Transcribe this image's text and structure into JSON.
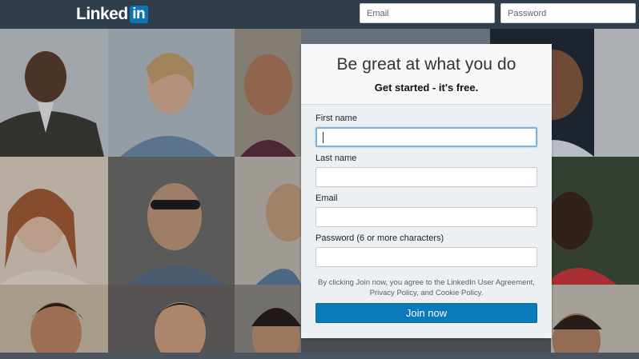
{
  "header": {
    "logo_text": "Linked",
    "logo_badge": "in",
    "email_placeholder": "Email",
    "password_placeholder": "Password"
  },
  "signup": {
    "title": "Be great at what you do",
    "subtitle": "Get started - it's free.",
    "fields": [
      {
        "label": "First name",
        "value": ""
      },
      {
        "label": "Last name",
        "value": ""
      },
      {
        "label": "Email",
        "value": ""
      },
      {
        "label": "Password (6 or more characters)",
        "value": ""
      }
    ],
    "legal_line1": "By clicking Join now, you agree to the LinkedIn User Agreement,",
    "legal_line2": "Privacy Policy, and Cookie Policy.",
    "join_label": "Join now"
  },
  "colors": {
    "topbar": "#2f3e4a",
    "brand_blue": "#0a77b5",
    "button_blue": "#0a7bb8",
    "card_background": "#edf0f3"
  }
}
